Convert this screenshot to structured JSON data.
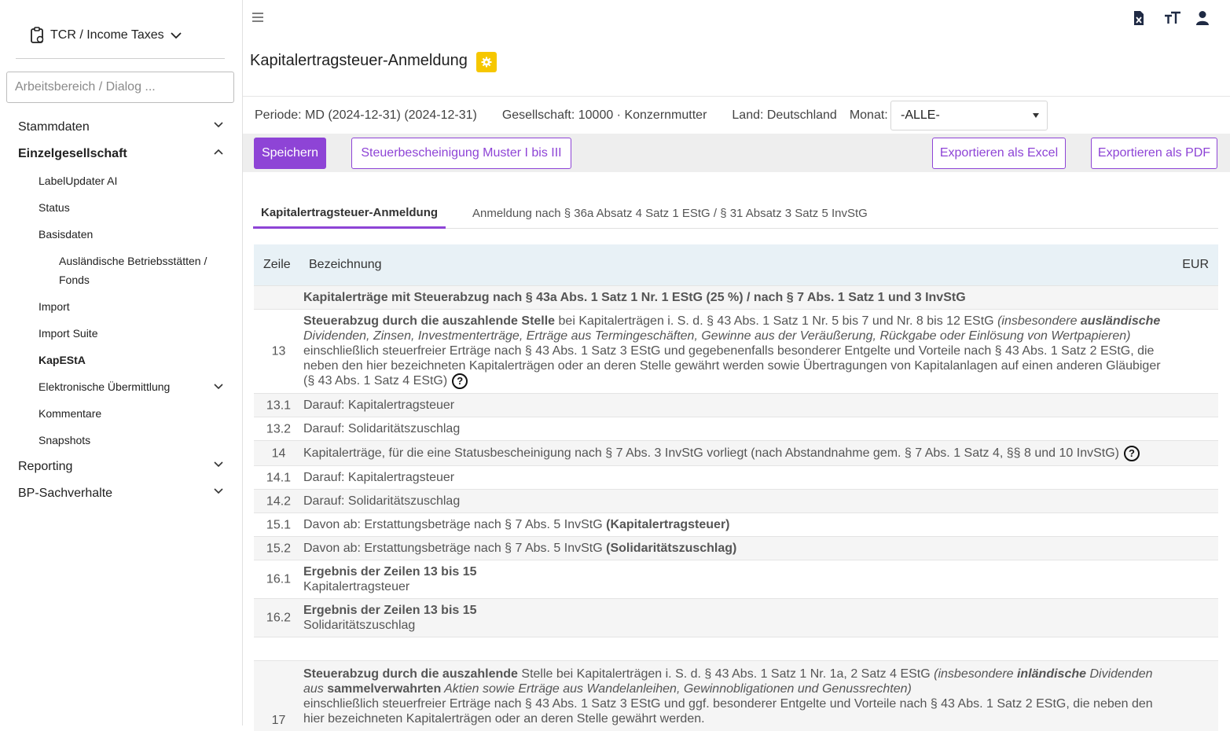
{
  "sidebar": {
    "app_title": "TCR / Income Taxes",
    "search_placeholder": "Arbeitsbereich / Dialog ...",
    "items": {
      "stammdaten": "Stammdaten",
      "einzelgesellschaft": "Einzelgesellschaft",
      "labelupdater": "LabelUpdater AI",
      "status": "Status",
      "basisdaten": "Basisdaten",
      "auslaendische_line1": "Ausländische Betriebsstätten /",
      "auslaendische_line2": "Fonds",
      "import": "Import",
      "import_suite": "Import Suite",
      "kapesta": "KapEStA",
      "elektronische": "Elektronische Übermittlung",
      "kommentare": "Kommentare",
      "snapshots": "Snapshots",
      "reporting": "Reporting",
      "bp": "BP-Sachverhalte"
    }
  },
  "header": {
    "page_title": "Kapitalertragsteuer-Anmeldung",
    "icons": [
      "excel-export-icon",
      "text-size-icon",
      "user-icon"
    ]
  },
  "filters": {
    "periode": "Periode: MD (2024-12-31) (2024-12-31)",
    "gesellschaft": "Gesellschaft: 10000 · Konzernmutter",
    "land": "Land: Deutschland",
    "monat_label": "Monat:",
    "monat_value": "-ALLE-"
  },
  "toolbar": {
    "save": "Speichern",
    "muster": "Steuerbescheinigung Muster I bis III",
    "excel": "Exportieren als Excel",
    "pdf": "Exportieren als PDF"
  },
  "tabs": {
    "tab1": "Kapitalertragsteuer-Anmeldung",
    "tab2": "Anmeldung nach § 36a Absatz 4 Satz 1 EStG / § 31 Absatz 3 Satz 5 InvStG"
  },
  "table": {
    "headers": {
      "zeile": "Zeile",
      "bezeichnung": "Bezeichnung",
      "eur": "EUR"
    },
    "section_title": "Kapitalerträge mit Steuerabzug nach § 43a Abs. 1 Satz 1 Nr. 1 EStG (25 %) / nach § 7 Abs. 1 Satz 1 und 3 InvStG",
    "r13": {
      "num": "13",
      "bold": "Steuerabzug durch die auszahlende Stelle",
      "plain": " bei Kapitalerträgen i. S. d. § 43 Abs. 1 Satz 1 Nr. 5 bis 7 und Nr. 8 bis 12 EStG ",
      "ital1": "(insbesondere ",
      "ital_bold": "ausländische",
      "ital2": " Dividenden, Zinsen, Investmenterträge, Erträge aus Termingeschäften, Gewinne aus der Veräußerung, Rückgabe oder Einlösung von Wertpapieren)",
      "rest": "einschließlich steuerfreier Erträge nach § 43 Abs. 1 Satz 3 EStG und gegebenenfalls besonderer Entgelte und Vorteile nach § 43 Abs. 1 Satz 2 EStG, die neben den hier bezeichneten Kapitalerträgen oder an deren Stelle gewährt werden sowie Übertragungen von Kapitalanlagen auf einen anderen Gläubiger (§ 43 Abs. 1 Satz 4 EStG)"
    },
    "r13_1": {
      "num": "13.1",
      "text": "Darauf: Kapitalertragsteuer"
    },
    "r13_2": {
      "num": "13.2",
      "text": "Darauf: Solidaritätszuschlag"
    },
    "r14": {
      "num": "14",
      "text": "Kapitalerträge, für die eine Statusbescheinigung nach § 7 Abs. 3 InvStG vorliegt (nach Abstandnahme gem. § 7 Abs. 1 Satz 4, §§ 8 und 10 InvStG)"
    },
    "r14_1": {
      "num": "14.1",
      "text": "Darauf: Kapitalertragsteuer"
    },
    "r14_2": {
      "num": "14.2",
      "text": "Darauf: Solidaritätszuschlag"
    },
    "r15_1": {
      "num": "15.1",
      "text": "Davon ab: Erstattungsbeträge nach § 7 Abs. 5 InvStG ",
      "bold": "(Kapitalertragsteuer)"
    },
    "r15_2": {
      "num": "15.2",
      "text": "Davon ab: Erstattungsbeträge nach § 7 Abs. 5 InvStG ",
      "bold": "(Solidaritätszuschlag)"
    },
    "r16_1": {
      "num": "16.1",
      "bold": "Ergebnis der Zeilen 13 bis 15",
      "text": "Kapitalertragsteuer"
    },
    "r16_2": {
      "num": "16.2",
      "bold": "Ergebnis der Zeilen 13 bis 15",
      "text": "Solidaritätszuschlag"
    },
    "r17": {
      "num": "17",
      "bold": "Steuerabzug durch die auszahlende",
      "plain": " Stelle bei Kapitalerträgen i. S. d. § 43 Abs. 1 Satz 1 Nr. 1a, 2 Satz 4 EStG ",
      "ital1": "(insbesondere ",
      "ital_bold": "inländische",
      "ital2": " Dividenden aus ",
      "bold2": "sammelverwahrten",
      "ital3": " Aktien sowie Erträge aus Wandelanleihen, Gewinnobligationen und Genussrechten)",
      "rest": "einschließlich steuerfreier Erträge nach § 43 Abs. 1 Satz 3 EStG und ggf. besonderer Entgelte und Vorteile nach § 43 Abs. 1 Satz 2 EStG, die neben den hier bezeichneten Kapitalerträgen oder an deren Stelle gewährt werden."
    }
  },
  "colors": {
    "accent": "#8e44d6",
    "badge": "#f6c700",
    "table_header": "#e8f1f6"
  }
}
